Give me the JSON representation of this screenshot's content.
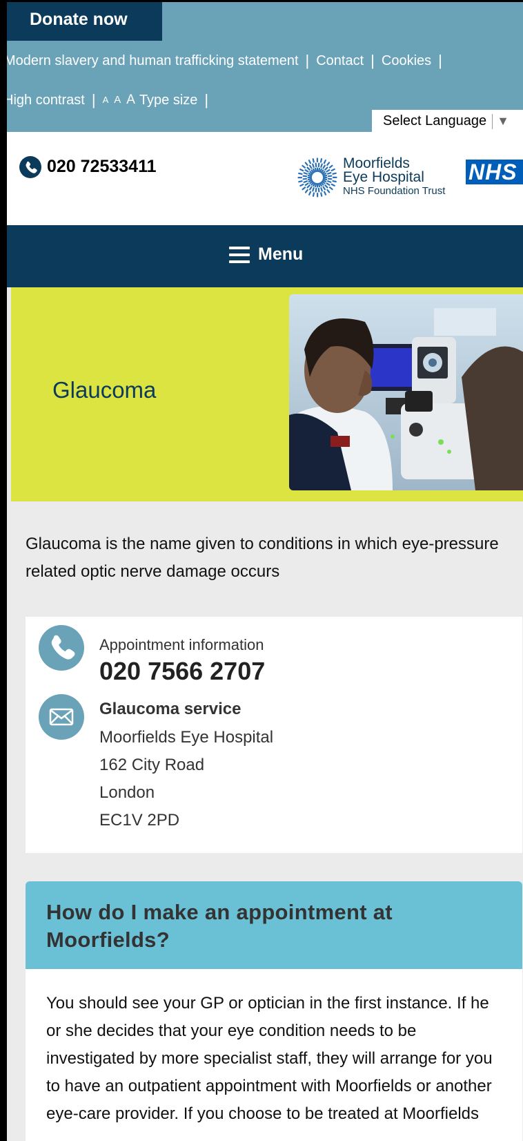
{
  "top_bar": {
    "donate_label": "Donate now",
    "links": [
      "Modern slavery and human trafficking statement",
      "Contact",
      "Cookies"
    ],
    "high_contrast": "High contrast",
    "type_size_label": "Type size",
    "type_size_glyphs": [
      "A",
      "A",
      "A"
    ],
    "language_select": "Select Language"
  },
  "header": {
    "phone": "020 72533411",
    "logo": {
      "line1": "Moorfields",
      "line2": "Eye Hospital",
      "line3": "NHS Foundation Trust"
    },
    "nhs_badge": "NHS"
  },
  "nav": {
    "menu_label": "Menu"
  },
  "hero": {
    "title": "Glaucoma"
  },
  "intro": "Glaucoma is the name given to conditions in which eye-pressure related optic nerve damage occurs",
  "contact": {
    "appointment_label": "Appointment information",
    "appointment_phone": "020 7566 2707",
    "service_name": "Glaucoma service",
    "address": [
      "Moorfields Eye Hospital",
      "162 City Road",
      "London",
      "EC1V 2PD"
    ]
  },
  "faq": {
    "question": "How do I make an appointment at Moorfields?",
    "answer": "You should see your GP or optician in the first instance.  If he or she decides that your eye condition needs to be investigated by more specialist staff, they will arrange for you to have an outpatient appointment with Moorfields or another eye-care provider.  If you choose to be treated at Moorfields"
  },
  "colors": {
    "navy": "#0c3a5b",
    "teal": "#6aa3b8",
    "lime": "#dce442",
    "faq_header": "#6ac1d5",
    "nhs_blue": "#005eb8"
  },
  "icons": {
    "phone": "phone-icon",
    "mail": "envelope-icon",
    "menu": "hamburger-icon",
    "dropdown": "triangle-down-icon"
  }
}
